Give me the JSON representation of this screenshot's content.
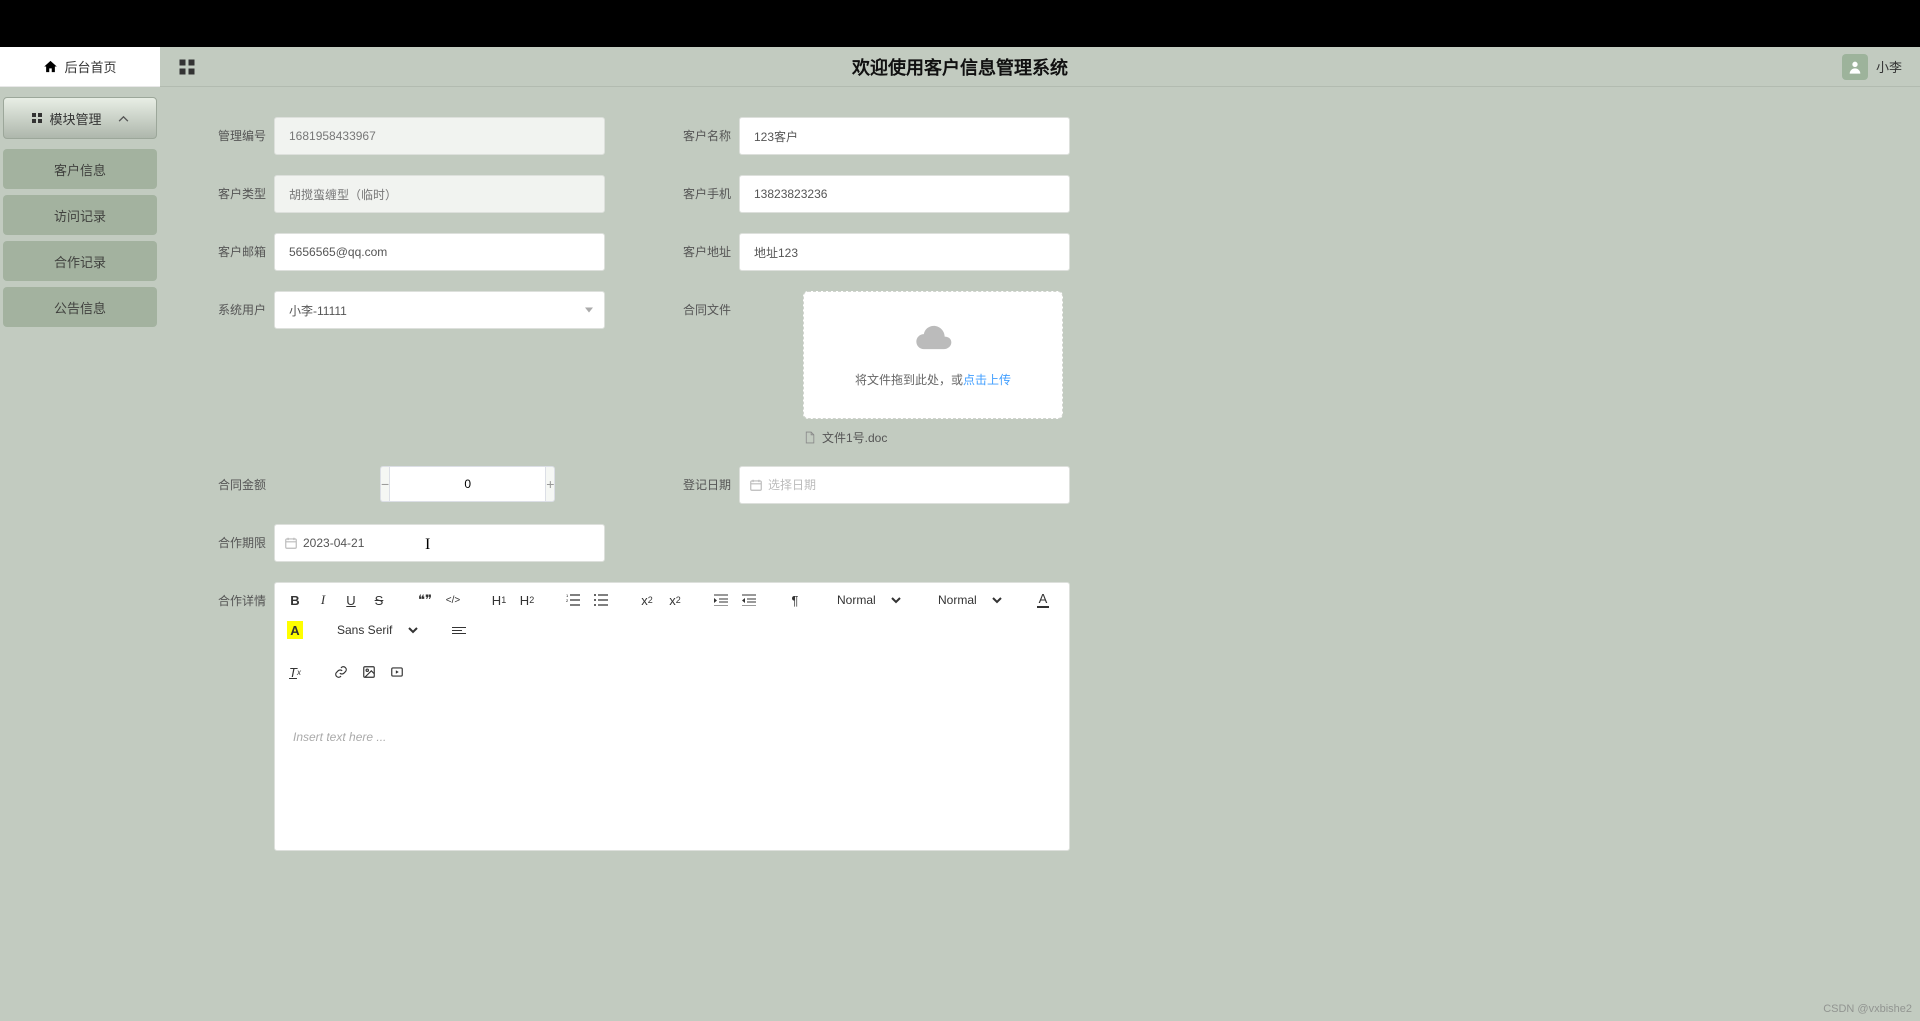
{
  "header": {
    "title": "欢迎使用客户信息管理系统",
    "user_name": "小李"
  },
  "sidebar": {
    "home_label": "后台首页",
    "group_label": "模块管理",
    "items": [
      {
        "label": "客户信息"
      },
      {
        "label": "访问记录"
      },
      {
        "label": "合作记录"
      },
      {
        "label": "公告信息"
      }
    ]
  },
  "form": {
    "manage_id_label": "管理编号",
    "manage_id_value": "1681958433967",
    "customer_name_label": "客户名称",
    "customer_name_value": "123客户",
    "customer_type_label": "客户类型",
    "customer_type_value": "胡搅蛮缠型（临时）",
    "customer_phone_label": "客户手机",
    "customer_phone_value": "13823823236",
    "customer_email_label": "客户邮箱",
    "customer_email_value": "5656565@qq.com",
    "customer_address_label": "客户地址",
    "customer_address_value": "地址123",
    "system_user_label": "系统用户",
    "system_user_value": "小李-11111",
    "contract_file_label": "合同文件",
    "upload_hint_prefix": "将文件拖到此处，或",
    "upload_hint_link": "点击上传",
    "uploaded_file": "文件1号.doc",
    "contract_amount_label": "合同金额",
    "contract_amount_value": "0",
    "register_date_label": "登记日期",
    "register_date_placeholder": "选择日期",
    "coop_deadline_label": "合作期限",
    "coop_deadline_value": "2023-04-21",
    "coop_detail_label": "合作详情"
  },
  "editor": {
    "toolbar": {
      "bold": "B",
      "italic": "I",
      "underline": "U",
      "strike": "S",
      "quote": "❝❞",
      "code": "</>",
      "h1": "H₁",
      "h2": "H₂",
      "sub": "x₂",
      "sup": "x²",
      "normal1": "Normal",
      "normal2": "Normal",
      "colorA": "A",
      "bgA": "A",
      "font": "Sans Serif",
      "clear": "Tx"
    },
    "placeholder": "Insert text here ..."
  },
  "watermark": "CSDN @vxbishe2"
}
